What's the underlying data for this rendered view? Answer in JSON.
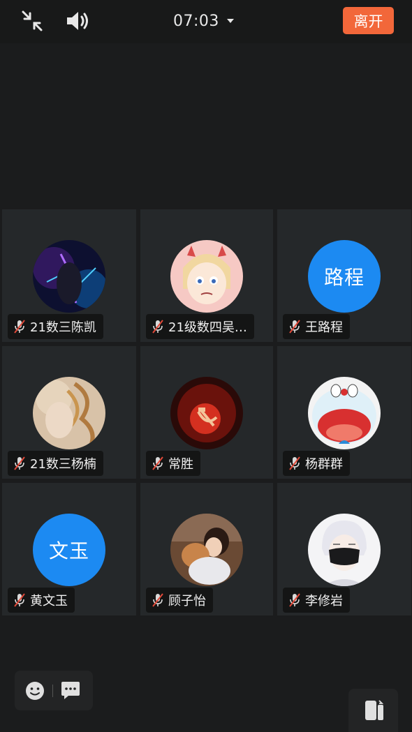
{
  "header": {
    "timer": "07:03",
    "leave_label": "离开",
    "icons": {
      "collapse": "collapse-arrows-icon",
      "speaker": "speaker-icon",
      "timer_dropdown": "caret-down-icon"
    }
  },
  "participants": [
    {
      "name": "21数三陈凯",
      "avatar_type": "image",
      "avatar_desc": "dark purple lightning character"
    },
    {
      "name": "21级数四吴…",
      "avatar_type": "image",
      "avatar_desc": "cartoon girl with devil horns"
    },
    {
      "name": "王路程",
      "avatar_type": "text",
      "avatar_text": "路程"
    },
    {
      "name": "21数三杨楠",
      "avatar_type": "image",
      "avatar_desc": "portrait with golden flowers"
    },
    {
      "name": "常胜",
      "avatar_type": "image",
      "avatar_desc": "red hammer and sickle emblem"
    },
    {
      "name": "杨群群",
      "avatar_type": "image",
      "avatar_desc": "blue cartoon cat face"
    },
    {
      "name": "黄文玉",
      "avatar_type": "text",
      "avatar_text": "文玉"
    },
    {
      "name": "顾子怡",
      "avatar_type": "image",
      "avatar_desc": "two people embracing"
    },
    {
      "name": "李修岩",
      "avatar_type": "image",
      "avatar_desc": "anime boy with black mask"
    }
  ],
  "mic_status_icon": "mic-muted-icon",
  "footer": {
    "emoji_icon": "emoji-icon",
    "chat_icon": "chat-icon",
    "switch_icon": "switch-device-icon"
  },
  "colors": {
    "leave_button": "#f2673a",
    "text_avatar": "#1c8af2",
    "mute_slash": "#e24a3a"
  }
}
